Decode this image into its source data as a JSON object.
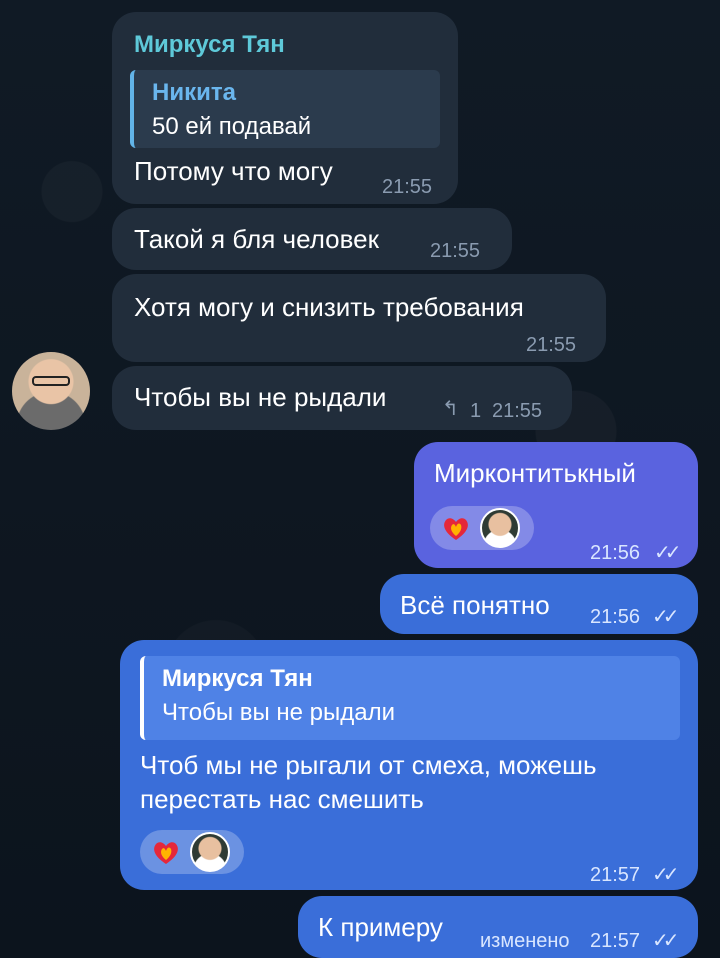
{
  "messages": [
    {
      "sender": "Миркуся Тян",
      "reply": {
        "name": "Никита",
        "text": "50 ей подавай"
      },
      "text": "Потому что могу",
      "time": "21:55"
    },
    {
      "text": "Такой я бля человек",
      "time": "21:55"
    },
    {
      "text": "Хотя могу и снизить требования",
      "time": "21:55"
    },
    {
      "text": "Чтобы вы не рыдали",
      "reply_count": "1",
      "time": "21:55"
    },
    {
      "text": "Мирконтитькный",
      "time": "21:56",
      "reactions": [
        "heart-fire",
        "avatar"
      ]
    },
    {
      "text": "Всё понятно",
      "time": "21:56"
    },
    {
      "reply": {
        "name": "Миркуся Тян",
        "text": "Чтобы вы не рыдали"
      },
      "text_line1": "Чтоб мы не рыгали от смеха, можешь",
      "text_line2": "перестать нас смешить",
      "time": "21:57",
      "reactions": [
        "heart-fire",
        "avatar"
      ]
    },
    {
      "text": "К примеру",
      "edited": "изменено",
      "time": "21:57"
    }
  ],
  "colors": {
    "background": "#0e1621",
    "incoming": "#212d3b",
    "outgoing": "#3a6ed9",
    "outgoing_violet": "#5a63df",
    "sender_name": "#5ec9d9"
  }
}
